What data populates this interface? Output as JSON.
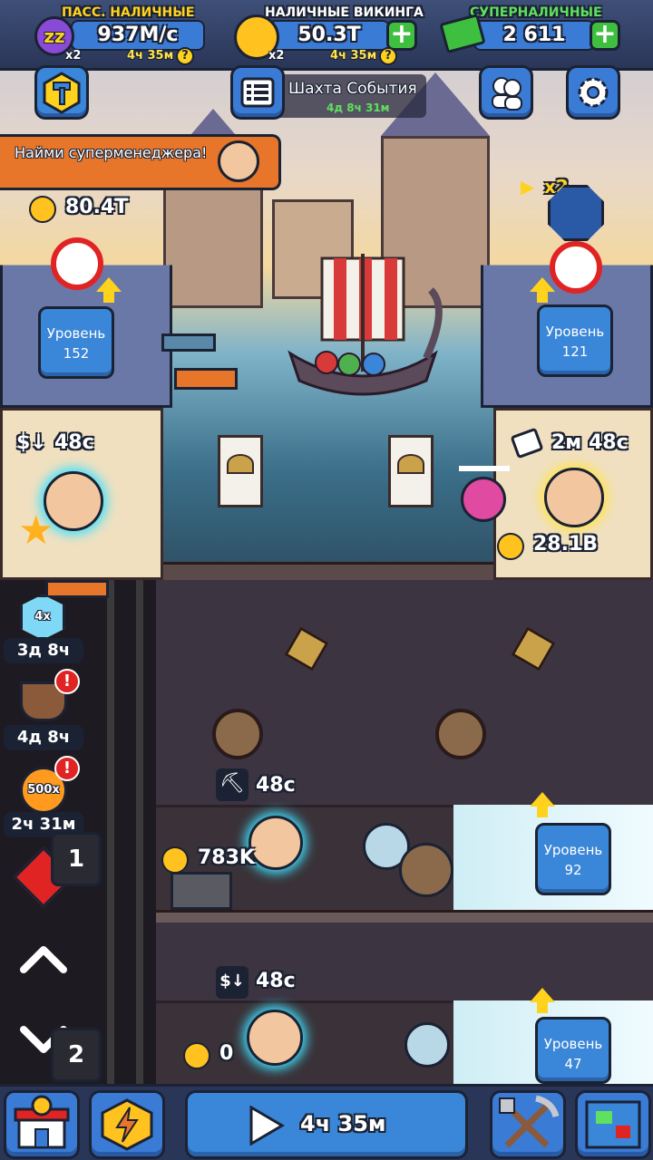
{
  "top_bar": {
    "passive_cash": {
      "title": "ПАСС. НАЛИЧНЫЕ",
      "value": "937M/c",
      "multiplier": "x2",
      "timer": "4ч 35м",
      "help": "?"
    },
    "viking_cash": {
      "title": "НАЛИЧНЫЕ ВИКИНГА",
      "value": "50.3T",
      "multiplier": "x2",
      "timer": "4ч 35м",
      "help": "?",
      "plus": "+"
    },
    "super_cash": {
      "title": "СУПЕРНАЛИЧНЫЕ",
      "value": "2 611",
      "plus": "+"
    }
  },
  "event": {
    "title": "Шахта События",
    "timer": "4д 8ч 31м"
  },
  "hire_banner": {
    "text": "Найми суперменеджера!"
  },
  "warehouse": {
    "cash": "80.4T",
    "level_label": "Уровень",
    "level": "152",
    "manager_timer": "48с"
  },
  "elevator": {
    "x2_label": "x2",
    "level_label": "Уровень",
    "level": "121",
    "manager_timer": "2м 48с",
    "carry": "28.1B"
  },
  "boosts": [
    {
      "label": "4x",
      "timer": "3д 8ч",
      "alert": ""
    },
    {
      "label": "",
      "timer": "4д 8ч",
      "alert": "!"
    },
    {
      "label": "500x",
      "timer": "2ч 31м",
      "alert": "!"
    }
  ],
  "nav": {
    "shaft_top": "1",
    "shaft_bottom": "2"
  },
  "shafts": [
    {
      "manager_timer": "48с",
      "cash": "783K",
      "level_label": "Уровень",
      "level": "92"
    },
    {
      "manager_timer": "48с",
      "cash": "0",
      "level_label": "Уровень",
      "level": "47"
    }
  ],
  "bottom_bar": {
    "boost_timer": "4ч 35м"
  },
  "colors": {
    "accent_blue": "#3a7bd5",
    "gold": "#ffd21e",
    "green": "#3fbf3f",
    "banner_orange": "#e8762a"
  }
}
